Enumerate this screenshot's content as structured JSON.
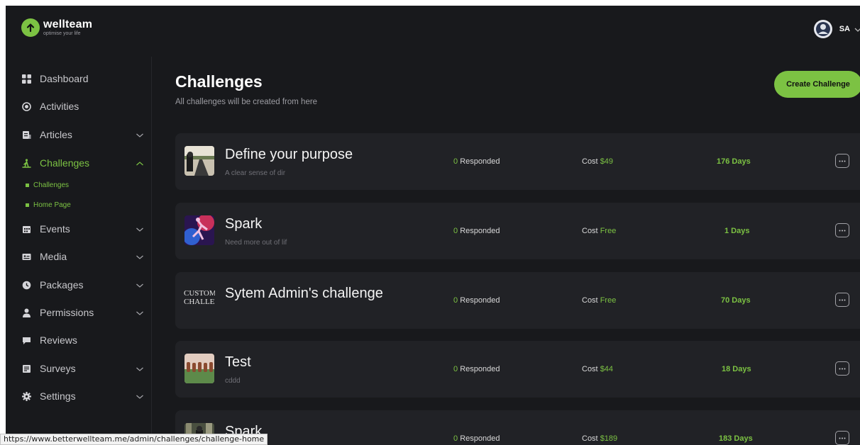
{
  "brand": {
    "name": "wellteam",
    "tagline": "optimise your life",
    "accent": "#7cc243"
  },
  "user": {
    "initials": "SA"
  },
  "sidebar": {
    "items": [
      {
        "label": "Dashboard",
        "icon": "grid-icon"
      },
      {
        "label": "Activities",
        "icon": "target-icon"
      },
      {
        "label": "Articles",
        "icon": "article-icon"
      },
      {
        "label": "Challenges",
        "icon": "hiking-icon",
        "active": true,
        "sub_items": [
          {
            "label": "Challenges"
          },
          {
            "label": "Home Page"
          }
        ]
      },
      {
        "label": "Events",
        "icon": "calendar-icon"
      },
      {
        "label": "Media",
        "icon": "media-icon"
      },
      {
        "label": "Packages",
        "icon": "package-icon"
      },
      {
        "label": "Permissions",
        "icon": "person-icon"
      },
      {
        "label": "Reviews",
        "icon": "review-icon"
      },
      {
        "label": "Surveys",
        "icon": "survey-icon"
      },
      {
        "label": "Settings",
        "icon": "gear-icon"
      }
    ]
  },
  "main": {
    "title": "Challenges",
    "subtitle": "All challenges will be created from here",
    "create_label": "Create Challenge",
    "responded_label": "Responded",
    "cost_label": "Cost",
    "challenges": [
      {
        "title": "Define your purpose",
        "description": "A clear sense of dir",
        "responded": "0",
        "cost": "$49",
        "days": "176 Days",
        "thumbnail": "road-photo"
      },
      {
        "title": "Spark",
        "description": "Need more out of lif",
        "responded": "0",
        "cost": "Free",
        "days": "1 Days",
        "thumbnail": "neon-runner-photo"
      },
      {
        "title": "Sytem Admin's challenge",
        "description": "",
        "responded": "0",
        "cost": "Free",
        "days": "70 Days",
        "thumbnail": "text-thumbnail",
        "thumb_text": [
          "CUSTOM",
          "CHALLENGE"
        ]
      },
      {
        "title": "Test",
        "description": "cddd",
        "responded": "0",
        "cost": "$44",
        "days": "18 Days",
        "thumbnail": "group-photo"
      },
      {
        "title": "Spark",
        "description": "",
        "responded": "0",
        "cost": "$189",
        "days": "183 Days",
        "thumbnail": "forest-photo"
      }
    ]
  },
  "status_url": "https://www.betterwellteam.me/admin/challenges/challenge-home"
}
